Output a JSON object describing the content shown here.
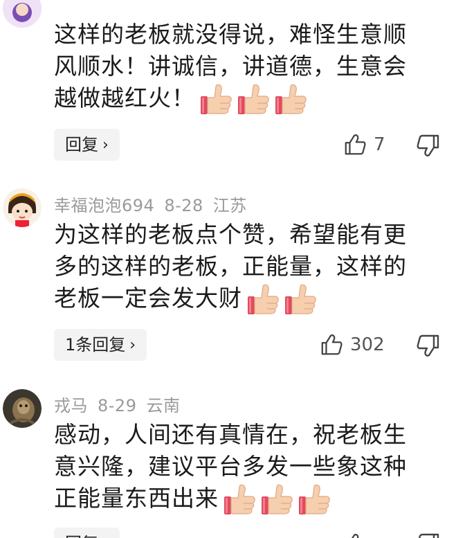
{
  "comments": [
    {
      "text_lines": [
        "这样的老板就没得说，难怪生意顺",
        "风顺水！讲诚信，讲道德，生意会",
        "越做越红火！"
      ],
      "emoji_count": 3,
      "reply_label": "回复",
      "likes": "7"
    },
    {
      "username": "幸福泡泡694",
      "date": "8-28",
      "location": "江苏",
      "text_lines": [
        "为这样的老板点个赞，希望能有更",
        "多的这样的老板，正能量，这样的",
        "老板一定会发大财"
      ],
      "emoji_count": 2,
      "reply_label": "1条回复",
      "likes": "302"
    },
    {
      "username": "戎马",
      "date": "8-29",
      "location": "云南",
      "text_lines": [
        "感动，人间还有真情在，祝老板生",
        "意兴隆，建议平台多发一些象这种",
        "正能量东西出来"
      ],
      "emoji_count": 3,
      "reply_label": "回复"
    }
  ],
  "icons": {
    "like": "thumbs-up-outline-icon",
    "dislike": "thumbs-down-outline-icon",
    "reply_chevron": "chevron-right-icon",
    "emoji": "thumbs-up-emoji"
  },
  "colors": {
    "meta_text": "#9a9a9a",
    "body_text": "#1b1b1b",
    "reply_bg": "#f3f3f3",
    "emoji_skin": "#f4c9a8",
    "emoji_cuff": "#e24a5e"
  }
}
